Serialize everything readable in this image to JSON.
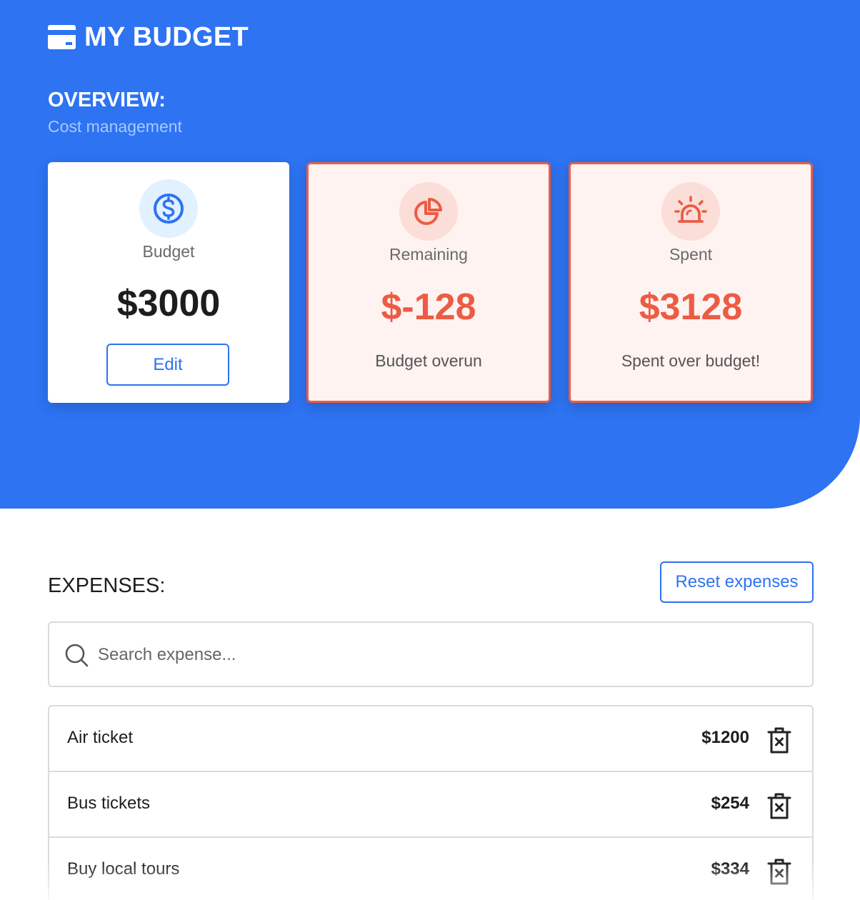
{
  "app": {
    "title": "MY BUDGET",
    "icon": "wallet-card-icon"
  },
  "overview": {
    "title": "OVERVIEW:",
    "subtitle": "Cost management"
  },
  "cards": {
    "budget": {
      "label": "Budget",
      "value": "$3000",
      "edit_label": "Edit",
      "icon": "dollar-circle-icon"
    },
    "remaining": {
      "label": "Remaining",
      "value": "$-128",
      "note": "Budget overun",
      "icon": "pie-chart-icon"
    },
    "spent": {
      "label": "Spent",
      "value": "$3128",
      "note": "Spent over budget!",
      "icon": "siren-alarm-icon"
    }
  },
  "expenses": {
    "title": "EXPENSES:",
    "reset_label": "Reset expenses",
    "search_placeholder": "Search expense...",
    "search_value": "",
    "items": [
      {
        "name": "Air ticket",
        "amount": "$1200"
      },
      {
        "name": "Bus tickets",
        "amount": "$254"
      },
      {
        "name": "Buy local tours",
        "amount": "$334"
      }
    ]
  },
  "colors": {
    "primary": "#2d73f2",
    "danger": "#ec5c44",
    "danger_bg": "#fff3f1",
    "subtitle": "#a9c8ff"
  }
}
